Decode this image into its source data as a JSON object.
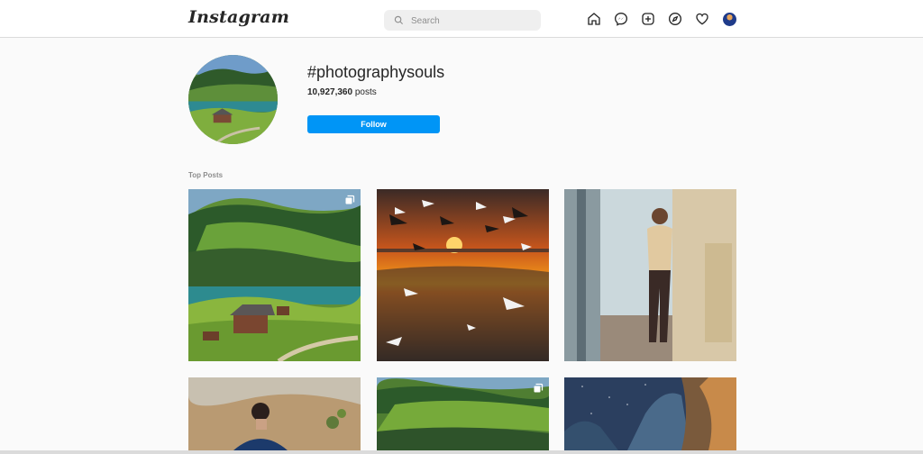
{
  "nav": {
    "logo_text": "Instagram",
    "search_placeholder": "Search",
    "icons": [
      "home-icon",
      "messenger-icon",
      "new-post-icon",
      "explore-icon",
      "activity-heart-icon",
      "profile-avatar"
    ]
  },
  "header": {
    "hashtag": "#photographysouls",
    "post_count": "10,927,360",
    "post_count_suffix": " posts",
    "follow_label": "Follow"
  },
  "top_posts": {
    "label": "Top Posts",
    "posts": [
      {
        "subject": "mountain valley with houses and lake",
        "multi": true
      },
      {
        "subject": "sunset over sea with seagulls",
        "multi": false
      },
      {
        "subject": "woman standing near train",
        "multi": false
      },
      {
        "subject": "man in mountain landscape",
        "multi": false
      },
      {
        "subject": "green mountain valley",
        "multi": true
      },
      {
        "subject": "rock cliffs under starry sky",
        "multi": false
      }
    ]
  },
  "colors": {
    "accent": "#0095f6",
    "background": "#fafafa",
    "text": "#262626",
    "muted": "#8e8e8e"
  }
}
